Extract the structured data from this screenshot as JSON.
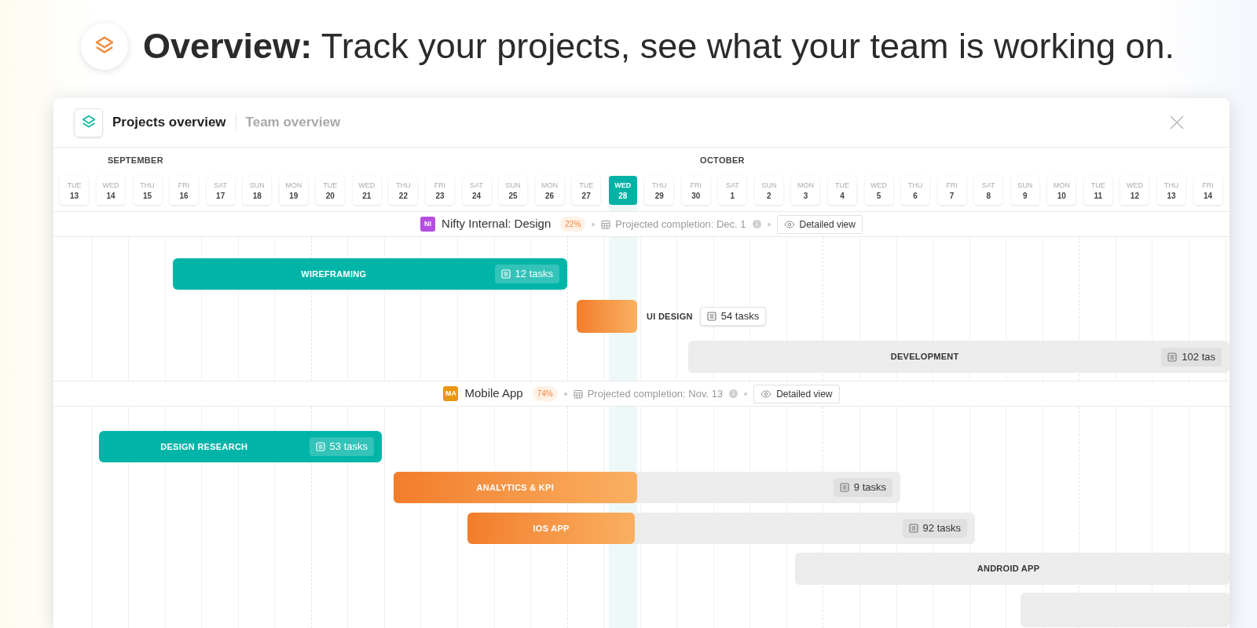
{
  "header": {
    "title": "**Overview:** Track your projects, see what your team is working on."
  },
  "window": {
    "tabs": [
      {
        "label": "Projects overview",
        "selected": true
      },
      {
        "label": "Team overview",
        "selected": false
      }
    ]
  },
  "timeline": {
    "months": [
      {
        "label": "SEPTEMBER"
      },
      {
        "label": "OCTOBER"
      }
    ],
    "days": [
      {
        "weekday": "TUE",
        "date": "13",
        "selected": false
      },
      {
        "weekday": "WED",
        "date": "14",
        "selected": false
      },
      {
        "weekday": "THU",
        "date": "15",
        "selected": false
      },
      {
        "weekday": "FRI",
        "date": "16",
        "selected": false
      },
      {
        "weekday": "SAT",
        "date": "17",
        "selected": false
      },
      {
        "weekday": "SUN",
        "date": "18",
        "selected": false
      },
      {
        "weekday": "MON",
        "date": "19",
        "selected": false
      },
      {
        "weekday": "TUE",
        "date": "20",
        "selected": false
      },
      {
        "weekday": "WED",
        "date": "21",
        "selected": false
      },
      {
        "weekday": "THU",
        "date": "22",
        "selected": false
      },
      {
        "weekday": "FRI",
        "date": "23",
        "selected": false
      },
      {
        "weekday": "SAT",
        "date": "24",
        "selected": false
      },
      {
        "weekday": "SUN",
        "date": "25",
        "selected": false
      },
      {
        "weekday": "MON",
        "date": "26",
        "selected": false
      },
      {
        "weekday": "TUE",
        "date": "27",
        "selected": false
      },
      {
        "weekday": "WED",
        "date": "28",
        "selected": true
      },
      {
        "weekday": "THU",
        "date": "29",
        "selected": false
      },
      {
        "weekday": "FRI",
        "date": "30",
        "selected": false
      },
      {
        "weekday": "SAT",
        "date": "1",
        "selected": false
      },
      {
        "weekday": "SUN",
        "date": "2",
        "selected": false
      },
      {
        "weekday": "MON",
        "date": "3",
        "selected": false
      },
      {
        "weekday": "TUE",
        "date": "4",
        "selected": false
      },
      {
        "weekday": "WED",
        "date": "5",
        "selected": false
      },
      {
        "weekday": "THU",
        "date": "6",
        "selected": false
      },
      {
        "weekday": "FRI",
        "date": "7",
        "selected": false
      },
      {
        "weekday": "SAT",
        "date": "8",
        "selected": false
      },
      {
        "weekday": "SUN",
        "date": "9",
        "selected": false
      },
      {
        "weekday": "MON",
        "date": "10",
        "selected": false
      },
      {
        "weekday": "TUE",
        "date": "11",
        "selected": false
      },
      {
        "weekday": "WED",
        "date": "12",
        "selected": false
      },
      {
        "weekday": "THU",
        "date": "13",
        "selected": false
      },
      {
        "weekday": "FRI",
        "date": "14",
        "selected": false
      }
    ]
  },
  "projects": [
    {
      "initials": "NI",
      "color": "#b44ee0",
      "name": "Nifty Internal: Design",
      "percent": "22%",
      "completion": "Projected completion: Dec. 1",
      "button": "Detailed view",
      "tasks": [
        {
          "kind": "done",
          "label": "WIREFRAMING",
          "count": "12 tasks"
        },
        {
          "kind": "in_progress",
          "label": "UI DESIGN",
          "count": "54 tasks",
          "level": 1
        },
        {
          "kind": "upcoming",
          "label": "DEVELOPMENT",
          "count": "102 tas"
        }
      ]
    },
    {
      "initials": "MA",
      "color": "#e8960c",
      "name": "Mobile App",
      "percent": "74%",
      "completion": "Projected completion: Nov. 13",
      "button": "Detailed view",
      "tasks": [
        {
          "kind": "done",
          "label": "DESIGN RESEARCH",
          "count": "53 tasks"
        },
        {
          "kind": "in_progress",
          "label": "ANALYTICS & KPI",
          "count": "9 tasks",
          "level": 0.48
        },
        {
          "kind": "in_progress",
          "label": "IOS APP",
          "count": "92 tasks",
          "level": 0.33
        },
        {
          "kind": "upcoming",
          "label": "ANDROID APP"
        },
        {
          "kind": "upcoming"
        }
      ]
    }
  ]
}
